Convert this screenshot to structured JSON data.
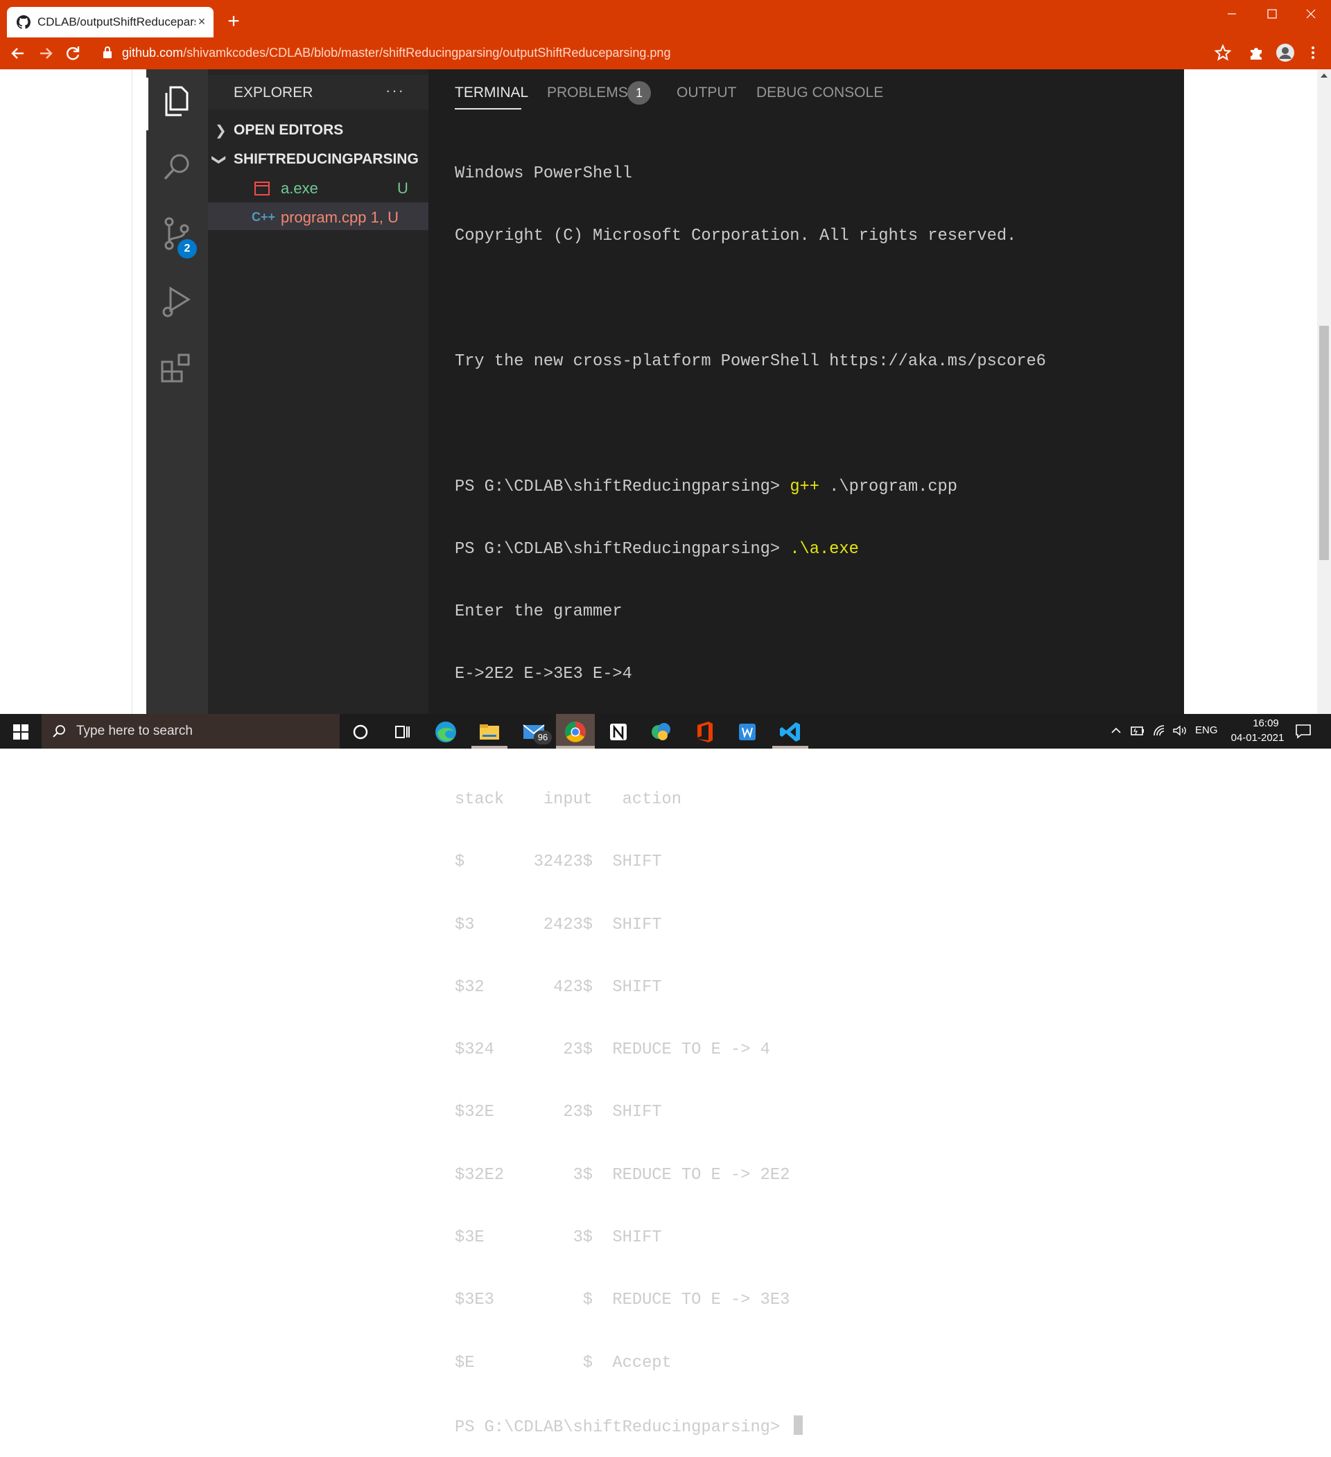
{
  "browser": {
    "tab_title": "CDLAB/outputShiftReduceparsing.png",
    "new_tab": "+",
    "close": "×",
    "url_host": "github.com",
    "url_path": "/shivamkcodes/CDLAB/blob/master/shiftReducingparsing/outputShiftReduceparsing.png",
    "accent": "#d83b01"
  },
  "vscode": {
    "explorer_title": "EXPLORER",
    "explorer_more": "···",
    "open_editors": "OPEN EDITORS",
    "project_folder": "SHIFTREDUCINGPARSING",
    "source_control_badge": "2",
    "files": [
      {
        "name": "a.exe",
        "status": "U",
        "icon": "window-icon",
        "color": "#73c991"
      },
      {
        "name": "program.cpp",
        "status": "1, U",
        "icon": "cpp-icon",
        "color": "#f48771",
        "lang": "C++"
      }
    ]
  },
  "panel": {
    "tabs": [
      "TERMINAL",
      "PROBLEMS",
      "OUTPUT",
      "DEBUG CONSOLE"
    ],
    "problems_count": "1"
  },
  "terminal": {
    "lines": [
      "Windows PowerShell",
      "Copyright (C) Microsoft Corporation. All rights reserved.",
      "",
      "Try the new cross-platform PowerShell https://aka.ms/pscore6",
      "",
      "PS G:\\CDLAB\\shiftReducingparsing> ",
      "PS G:\\CDLAB\\shiftReducingparsing> ",
      "Enter the grammer",
      "E->2E2 E->3E3 E->4",
      "",
      "stack    input   action",
      "$       32423$  SHIFT",
      "$3       2423$  SHIFT",
      "$32       423$  SHIFT",
      "$324       23$  REDUCE TO E -> 4",
      "$32E       23$  SHIFT",
      "$32E2       3$  REDUCE TO E -> 2E2",
      "$3E         3$  SHIFT",
      "$3E3         $  REDUCE TO E -> 3E3",
      "$E           $  Accept",
      "PS G:\\CDLAB\\shiftReducingparsing> "
    ],
    "cmd1_name": "g++",
    "cmd1_args": " .\\program.cpp",
    "cmd2": ".\\a.exe"
  },
  "taskbar": {
    "search_placeholder": "Type here to search",
    "mail_badge": "96",
    "language": "ENG",
    "time": "16:09",
    "date": "04-01-2021"
  }
}
